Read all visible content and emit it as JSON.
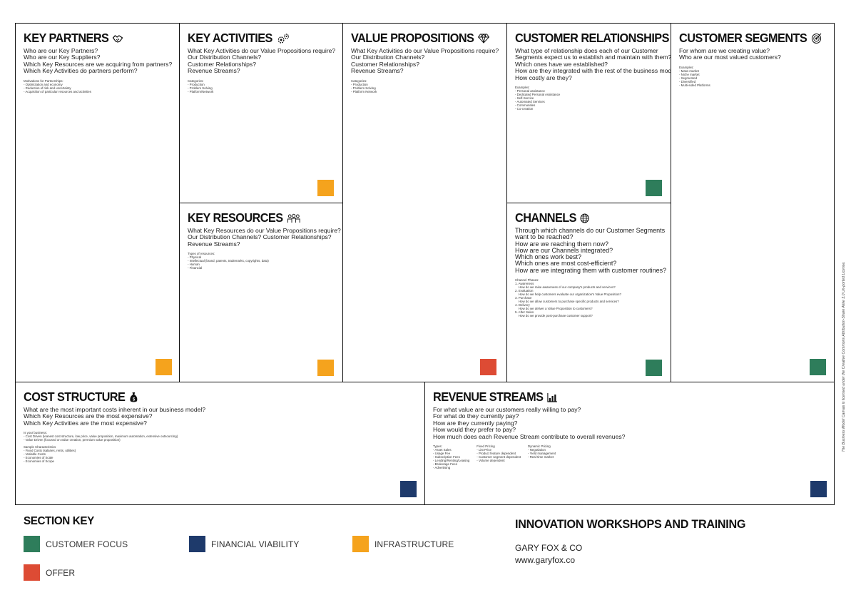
{
  "canvas": {
    "key_partners": {
      "title": "KEY PARTNERS",
      "questions": [
        "Who are our Key Partners?",
        "Who are our Key Suppliers?",
        "Which Key Resources are we acquiring from partners?",
        "Which Key Activities do partners perform?"
      ],
      "notes": "Motivations for Partnerships:\n- Optimization and economy\n- Reduction of risk and uncertainty\n- Acquisition of particular resources and activities"
    },
    "key_activities": {
      "title": "KEY ACTIVITIES",
      "questions": [
        "What Key Activities do our Value Propositions require?",
        "Our Distribution Channels?",
        "Customer Relationships?",
        "Revenue Streams?"
      ],
      "notes": "Categories:\n- Production\n- Problem Solving\n- Platform/Network"
    },
    "value_propositions": {
      "title": "VALUE PROPOSITIONS",
      "questions": [
        "What Key Activities do our Value Propositions require?",
        "Our Distribution Channels?",
        "Customer Relationships?",
        "Revenue Streams?"
      ],
      "notes": "Categories:\n- Production\n- Problem Solving\n- Platform Network"
    },
    "customer_relationships": {
      "title": "CUSTOMER RELATIONSHIPS",
      "questions": [
        "What type of relationship does each of our Customer",
        "Segments expect us to establish and maintain with them?",
        "Which ones have we established?",
        "How are they integrated with the rest of the business model?",
        "How costly are they?"
      ],
      "notes": "Examples:\n- Personal assistance\n- Dedicated Personal Assistance\n- Self-Service\n- Automated Services\n- Communities\n- Co-creation"
    },
    "customer_segments": {
      "title": "CUSTOMER SEGMENTS",
      "questions": [
        "For whom are we creating value?",
        "Who are our most valued customers?"
      ],
      "notes": "Examples:\n- Mass market\n- Niche market\n- Segmented\n- Diversified\n- Multi-sided Platforms"
    },
    "key_resources": {
      "title": "KEY RESOURCES",
      "questions": [
        "What Key Resources do our Value Propositions require?",
        "Our Distribution Channels? Customer Relationships?",
        "Revenue Streams?"
      ],
      "notes": "Types of resources:\n- Physical\n- Intellectual (brand, patents, trademarks, copyrights, data)\n- Human\n- Financial"
    },
    "channels": {
      "title": "CHANNELS",
      "questions": [
        "Through which channels do our Customer Segments",
        "want to be reached?",
        "How are we reaching them now?",
        "How are our Channels integrated?",
        "Which ones work best?",
        "Which ones are most cost-efficient?",
        "How are we integrating them with customer routines?"
      ],
      "notes": "Channel Phases:\n1. Awareness\n    How do we raise awareness of our company's products and services?\n2. Evaluation\n    How do we help customers evaluate our organization's Value Proposition?\n3. Purchase\n    How do we allow customers to purchase specific products and services?\n4. Delivery\n    How do we deliver a Value Proposition to customers?\n5. After Sales\n    How do we provide post-purchase customer support?"
    },
    "cost_structure": {
      "title": "COST STRUCTURE",
      "questions": [
        "What are the most important costs inherent in our business model?",
        "Which Key Resources are the most expensive?",
        "Which Key Activities are the most expensive?"
      ],
      "notes": "Is your business:\n- Cost Driven (leanest cost structure, low price, value proposition, maximum automation, extensive outsourcing)\n- Value Driven (focused on value creation, premium value proposition)\n\nSample Characteristics\n- Fixed Costs (salaries, rents, utilities)\n- Variable Costs\n- Economies of Scale\n- Economies of Scope"
    },
    "revenue_streams": {
      "title": "REVENUE STREAMS",
      "questions": [
        "For what value are our customers really willing to pay?",
        "For what do they currently pay?",
        "How are they currently paying?",
        "How would they prefer to pay?",
        "How much does each Revenue Stream contribute to overall revenues?"
      ],
      "notes_cols": [
        "Types:\n- Asset Sales\n- Usage Fee\n- Subscription Fees\n- Lending/Renting/Leasing\n- Brokerage Fees\n- Advertising",
        "Fixed Pricing\n- List Price\n- Product feature dependent\n- Customer segment dependent\n- Volume dependent",
        "Dynamic Pricing\n- Negotiation\n- Yield management\n- Real-time market"
      ]
    }
  },
  "section_key": {
    "title": "SECTION KEY",
    "items": [
      {
        "label": "CUSTOMER FOCUS",
        "color": "#2e7d5b"
      },
      {
        "label": "FINANCIAL VIABILITY",
        "color": "#1e3a6b"
      },
      {
        "label": "INFRASTRUCTURE",
        "color": "#f5a31d"
      },
      {
        "label": "OFFER",
        "color": "#dd4b34"
      }
    ]
  },
  "branding": {
    "title": "INNOVATION WORKSHOPS AND TRAINING",
    "company": "GARY FOX & CO",
    "url": "www.garyfox.co"
  },
  "license": "The Business Model Canvas  is licensed under the Creative Commons Attribution-Share Alike 3.0 Un-ported License.",
  "icons": {
    "key_partners": "handshake-icon",
    "key_activities": "gears-icon",
    "value_propositions": "diamond-icon",
    "customer_relationships": "heart-icon",
    "customer_segments": "target-icon",
    "key_resources": "people-icon",
    "channels": "globe-icon",
    "cost_structure": "money-bag-icon",
    "revenue_streams": "bar-chart-icon"
  }
}
